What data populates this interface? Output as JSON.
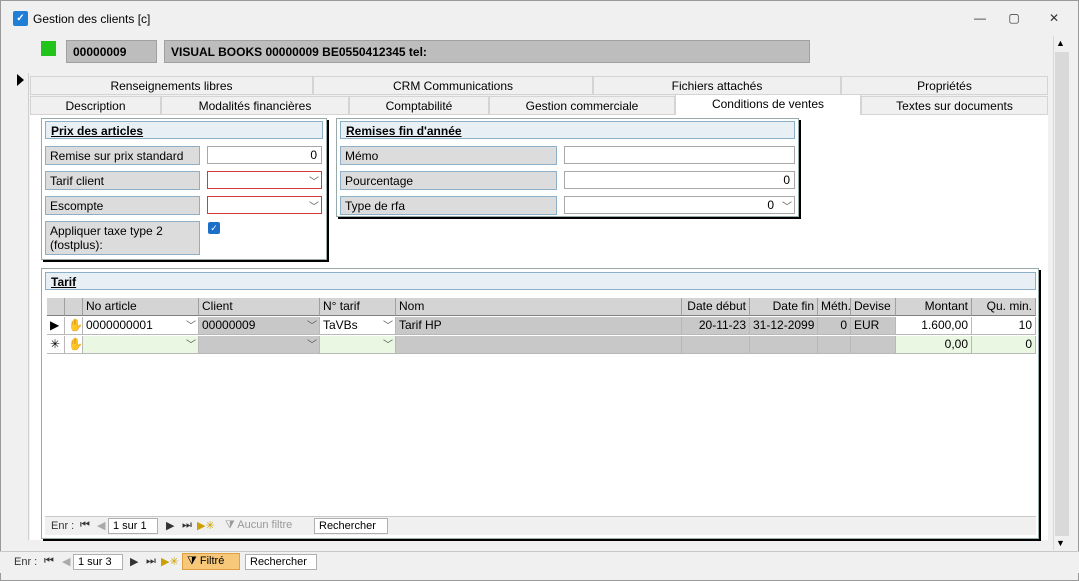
{
  "window": {
    "title": "Gestion des clients [c]",
    "minimize": "—",
    "restore": "▢",
    "close": "✕"
  },
  "header": {
    "code": "00000009",
    "name_line": "VISUAL BOOKS 00000009 BE0550412345 tel:",
    "status_color": "#22c41c"
  },
  "tabs_top": [
    "Renseignements libres",
    "CRM Communications",
    "Fichiers attachés",
    "Propriétés"
  ],
  "tabs_bottom": [
    "Description",
    "Modalités financières",
    "Comptabilité",
    "Gestion commerciale",
    "Conditions de ventes",
    "Textes sur documents"
  ],
  "active_tab": "Conditions de ventes",
  "prix": {
    "title": "Prix des articles",
    "remise_label": "Remise sur prix standard",
    "remise_value": "0",
    "tarif_client_label": "Tarif client",
    "tarif_client_value": "",
    "escompte_label": "Escompte",
    "escompte_value": "",
    "taxe_label": "Appliquer taxe type 2 (fostplus):",
    "taxe_checked": "✓"
  },
  "rfa": {
    "title": "Remises fin d'année",
    "memo_label": "Mémo",
    "memo_value": "",
    "pourcentage_label": "Pourcentage",
    "pourcentage_value": "0",
    "type_label": "Type de rfa",
    "type_value": "0"
  },
  "tarif": {
    "title": "Tarif",
    "columns": [
      "No article",
      "Client",
      "N° tarif",
      "Nom",
      "Date début",
      "Date fin",
      "Méth.",
      "Devise",
      "Montant",
      "Qu. min."
    ],
    "rows": [
      {
        "no_article": "0000000001",
        "client": "00000009",
        "n_tarif": "TaVBs",
        "nom": "Tarif HP",
        "date_debut": "20-11-23",
        "date_fin": "31-12-2099",
        "meth": "0",
        "devise": "EUR",
        "montant": "1.600,00",
        "qu_min": "10"
      }
    ],
    "new_row": {
      "montant": "0,00",
      "qu_min": "0"
    },
    "nav": {
      "label": "Enr :",
      "position": "1 sur 1",
      "filter": "Aucun filtre",
      "search": "Rechercher"
    }
  },
  "form_nav": {
    "label": "Enr :",
    "position": "1 sur 3",
    "filter": "Filtré",
    "search": "Rechercher"
  }
}
